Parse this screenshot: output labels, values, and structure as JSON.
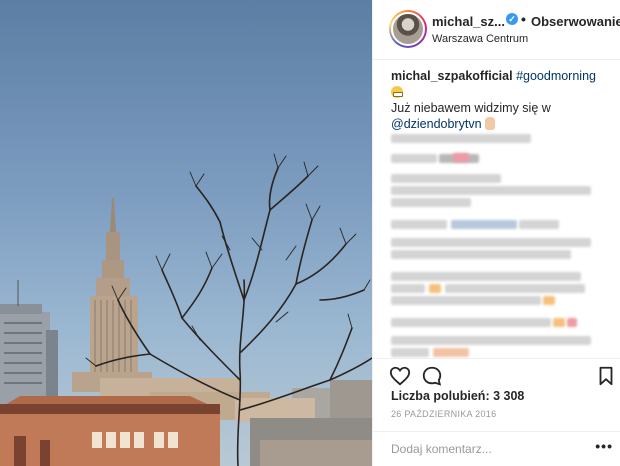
{
  "post": {
    "username": "michal_sz...",
    "verified_mark": "✓",
    "separator": "•",
    "follow_label": "Obserwowanie",
    "location": "Warszawa Centrum"
  },
  "caption": {
    "author": "michal_szpakofficial",
    "hashtag": "#goodmorning",
    "text": "Już niebawem widzimy się w",
    "mention": "@dziendobrytvn"
  },
  "stats": {
    "likes_text": "Liczba polubień: 3 308",
    "date": "26 PAŹDZIERNIKA 2016"
  },
  "comment_input": {
    "placeholder": "Dodaj komentarz..."
  },
  "more_label": "•••",
  "icons": {
    "like": "heart-icon",
    "comment": "speech-bubble-icon",
    "save": "bookmark-icon"
  },
  "colors": {
    "link": "#003569",
    "verified": "#3897f0",
    "text": "#262626",
    "muted": "#999999"
  }
}
